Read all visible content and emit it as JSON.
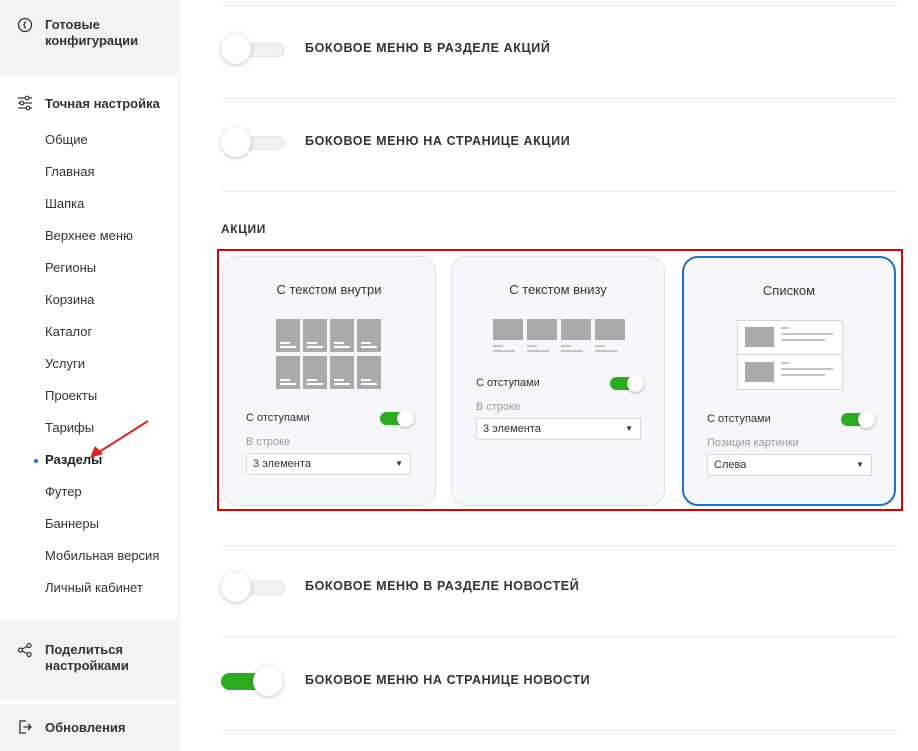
{
  "sidebar": {
    "top_block": {
      "icon": "compass-icon",
      "label": "Готовые конфигурации"
    },
    "section": {
      "icon": "sliders-icon",
      "label": "Точная настройка"
    },
    "items": [
      {
        "label": "Общие"
      },
      {
        "label": "Главная"
      },
      {
        "label": "Шапка"
      },
      {
        "label": "Верхнее меню"
      },
      {
        "label": "Регионы"
      },
      {
        "label": "Корзина"
      },
      {
        "label": "Каталог"
      },
      {
        "label": "Услуги"
      },
      {
        "label": "Проекты"
      },
      {
        "label": "Тарифы"
      },
      {
        "label": "Разделы",
        "active": true
      },
      {
        "label": "Футер"
      },
      {
        "label": "Баннеры"
      },
      {
        "label": "Мобильная версия"
      },
      {
        "label": "Личный кабинет"
      }
    ],
    "share_block": {
      "icon": "share-icon",
      "label": "Поделиться настройками"
    },
    "updates_block": {
      "icon": "logout-icon",
      "label": "Обновления"
    }
  },
  "main": {
    "rows": [
      {
        "label": "Боковое меню в разделе акций",
        "on": false
      },
      {
        "label": "Боковое меню на странице акции",
        "on": false
      },
      {
        "label": "Боковое меню в разделе новостей",
        "on": false
      },
      {
        "label": "Боковое меню на странице новости",
        "on": true
      }
    ],
    "section_title": "АКЦИИ",
    "cards": [
      {
        "title": "С текстом внутри",
        "option_label": "С отступами",
        "option_on": true,
        "select_label": "В строке",
        "select_value": "3 элемента",
        "selected": false
      },
      {
        "title": "С текстом внизу",
        "option_label": "С отступами",
        "option_on": true,
        "select_label": "В строке",
        "select_value": "3 элемента",
        "selected": false
      },
      {
        "title": "Списком",
        "option_label": "С отступами",
        "option_on": true,
        "select_label": "Позиция картинки",
        "select_value": "Слева",
        "selected": true
      }
    ]
  },
  "colors": {
    "accent_green": "#2bad1f",
    "selected_blue": "#1e73c8",
    "highlight_red": "#d90000",
    "active_dot": "#1a73e8"
  }
}
